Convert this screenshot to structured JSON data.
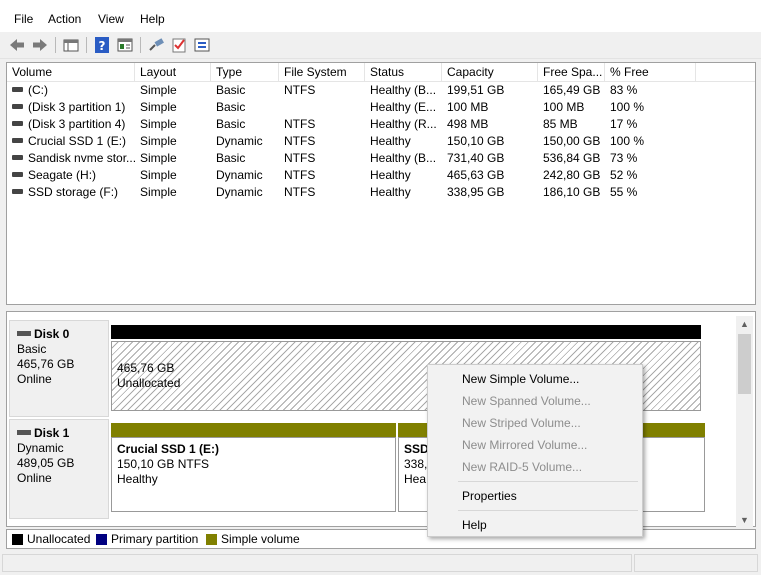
{
  "menu": {
    "file": "File",
    "action": "Action",
    "view": "View",
    "help": "Help"
  },
  "toolbar": {
    "buttons": [
      "back-arrow-icon",
      "forward-arrow-icon",
      "disk-list-icon",
      "help-icon",
      "properties-icon",
      "connect-icon",
      "check-icon",
      "settings-icon"
    ]
  },
  "volumes": {
    "columns": [
      "Volume",
      "Layout",
      "Type",
      "File System",
      "Status",
      "Capacity",
      "Free Spa...",
      "% Free"
    ],
    "rows": [
      [
        "(C:)",
        "Simple",
        "Basic",
        "NTFS",
        "Healthy (B...",
        "199,51 GB",
        "165,49 GB",
        "83 %"
      ],
      [
        "(Disk 3 partition 1)",
        "Simple",
        "Basic",
        "",
        "Healthy (E...",
        "100 MB",
        "100 MB",
        "100 %"
      ],
      [
        "(Disk 3 partition 4)",
        "Simple",
        "Basic",
        "NTFS",
        "Healthy (R...",
        "498 MB",
        "85 MB",
        "17 %"
      ],
      [
        "Crucial SSD 1 (E:)",
        "Simple",
        "Dynamic",
        "NTFS",
        "Healthy",
        "150,10 GB",
        "150,00 GB",
        "100 %"
      ],
      [
        "Sandisk nvme stor...",
        "Simple",
        "Basic",
        "NTFS",
        "Healthy (B...",
        "731,40 GB",
        "536,84 GB",
        "73 %"
      ],
      [
        "Seagate (H:)",
        "Simple",
        "Dynamic",
        "NTFS",
        "Healthy",
        "465,63 GB",
        "242,80 GB",
        "52 %"
      ],
      [
        "SSD storage (F:)",
        "Simple",
        "Dynamic",
        "NTFS",
        "Healthy",
        "338,95 GB",
        "186,10 GB",
        "55 %"
      ]
    ]
  },
  "disks": {
    "disk0": {
      "name": "Disk 0",
      "type": "Basic",
      "size": "465,76 GB",
      "state": "Online",
      "partition": {
        "size": "465,76 GB",
        "label": "Unallocated"
      }
    },
    "disk1": {
      "name": "Disk 1",
      "type": "Dynamic",
      "size": "489,05 GB",
      "state": "Online",
      "partitions": [
        {
          "title": "Crucial SSD 1  (E:)",
          "detail": "150,10 GB NTFS",
          "status": "Healthy"
        },
        {
          "title": "SSD",
          "detail": "338,",
          "status": "Hea"
        }
      ]
    }
  },
  "legend": [
    {
      "label": "Unallocated",
      "color": "#000000"
    },
    {
      "label": "Primary partition",
      "color": "#000080"
    },
    {
      "label": "Simple volume",
      "color": "#808000"
    }
  ],
  "context_menu": {
    "items": [
      {
        "label": "New Simple Volume...",
        "enabled": true
      },
      {
        "label": "New Spanned Volume...",
        "enabled": false
      },
      {
        "label": "New Striped Volume...",
        "enabled": false
      },
      {
        "label": "New Mirrored Volume...",
        "enabled": false
      },
      {
        "label": "New RAID-5 Volume...",
        "enabled": false
      },
      {
        "label": "Properties",
        "enabled": true
      },
      {
        "label": "Help",
        "enabled": true
      }
    ]
  },
  "colors": {
    "unallocated": "#000000",
    "primary": "#000080",
    "simple": "#808000"
  }
}
